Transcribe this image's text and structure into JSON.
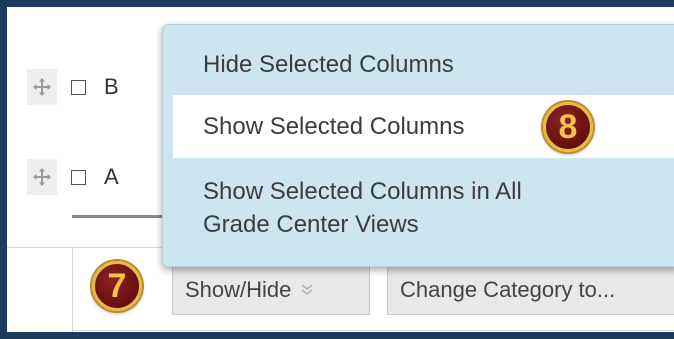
{
  "rows": [
    {
      "letter": "B"
    },
    {
      "letter": "A"
    }
  ],
  "toolbar": {
    "show_hide_label": "Show/Hide",
    "change_category_label": "Change Category to..."
  },
  "dropdown": {
    "items": [
      {
        "label": "Hide Selected Columns"
      },
      {
        "label": "Show Selected Columns"
      },
      {
        "label_line1": "Show Selected Columns in All",
        "label_line2": "Grade Center Views"
      }
    ]
  },
  "badges": {
    "step7": "7",
    "step8": "8"
  },
  "colors": {
    "frame": "#1b3a5c",
    "dropdown_bg": "#cde5ee",
    "badge_bg": "#6b1212",
    "badge_ring": "#e9b84a"
  }
}
